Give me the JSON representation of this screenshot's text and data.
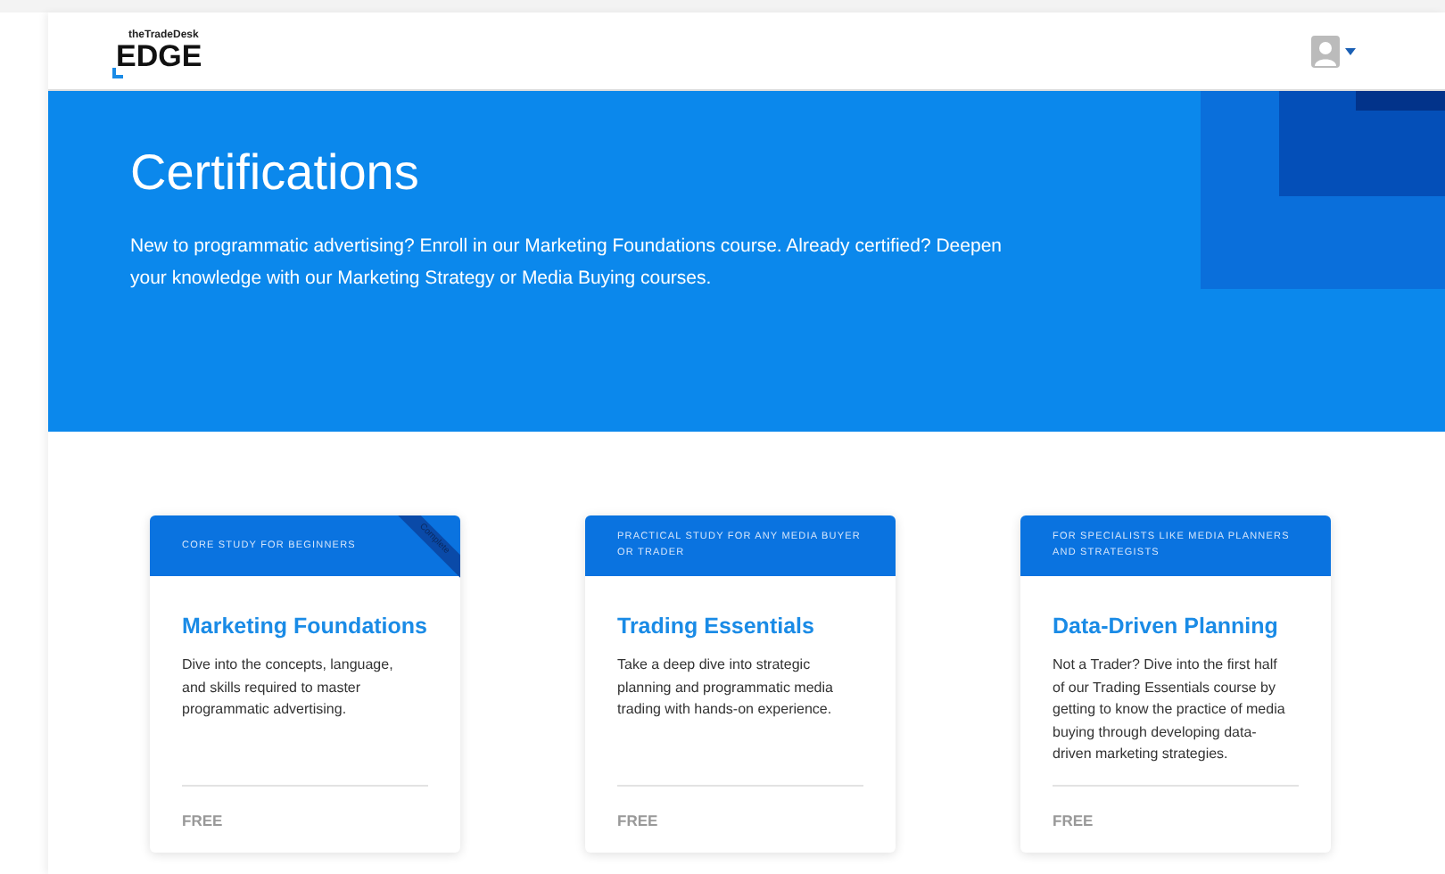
{
  "header": {
    "logo_small": "theTradeDesk",
    "logo": "EDGE"
  },
  "hero": {
    "title": "Certifications",
    "text": "New to programmatic advertising? Enroll in our Marketing Foundations course. Already certified? Deepen your knowledge with our Marketing Strategy or Media Buying courses."
  },
  "courses": [
    {
      "tag": "CORE STUDY FOR BEGINNERS",
      "title": "Marketing Foundations",
      "description": "Dive into the concepts, language, and skills required to master programmatic advertising.",
      "price": "FREE",
      "ribbon": "Complete"
    },
    {
      "tag": "PRACTICAL STUDY FOR ANY MEDIA BUYER OR TRADER",
      "title": "Trading Essentials",
      "description": "Take a deep dive into strategic planning and programmatic media trading with hands-on experience.",
      "price": "FREE"
    },
    {
      "tag": "FOR SPECIALISTS LIKE MEDIA PLANNERS AND STRATEGISTS",
      "title": "Data-Driven Planning",
      "description": "Not a Trader? Dive into the first half of our Trading Essentials course by getting to know the practice of media buying through developing data-driven marketing strategies.",
      "price": "FREE"
    }
  ]
}
